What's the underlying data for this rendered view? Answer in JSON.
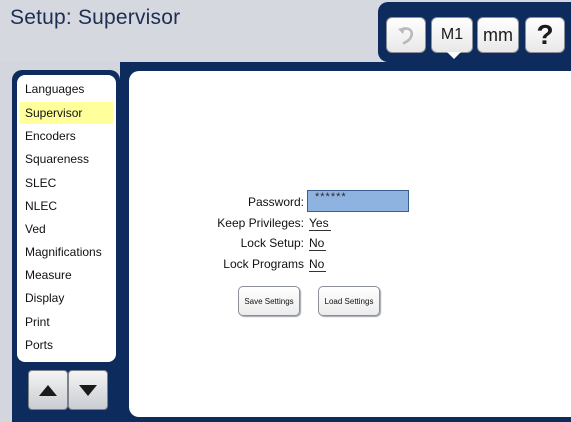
{
  "header": {
    "title": "Setup: Supervisor",
    "toolbar": {
      "undo_icon": "undo-icon",
      "m1_label": "M1",
      "mm_label": "mm",
      "help_label": "?"
    }
  },
  "sidebar": {
    "items": [
      {
        "label": "Languages",
        "selected": false
      },
      {
        "label": "Supervisor",
        "selected": true
      },
      {
        "label": "Encoders",
        "selected": false
      },
      {
        "label": "Squareness",
        "selected": false
      },
      {
        "label": "SLEC",
        "selected": false
      },
      {
        "label": "NLEC",
        "selected": false
      },
      {
        "label": "Ved",
        "selected": false
      },
      {
        "label": "Magnifications",
        "selected": false
      },
      {
        "label": "Measure",
        "selected": false
      },
      {
        "label": "Display",
        "selected": false
      },
      {
        "label": "Print",
        "selected": false
      },
      {
        "label": "Ports",
        "selected": false
      }
    ],
    "scroll": {
      "up_icon": "arrow-up-icon",
      "down_icon": "arrow-down-icon"
    }
  },
  "form": {
    "password": {
      "label": "Password:",
      "value": "******"
    },
    "keep_privileges": {
      "label": "Keep Privileges:",
      "value": "Yes"
    },
    "lock_setup": {
      "label": "Lock Setup:",
      "value": "No"
    },
    "lock_programs": {
      "label": "Lock Programs",
      "value": "No"
    },
    "save_button": "Save Settings",
    "load_button": "Load Settings"
  },
  "colors": {
    "frame": "#0d2b5c",
    "selection": "#ffff9c",
    "password_field": "#8fb3e0"
  }
}
